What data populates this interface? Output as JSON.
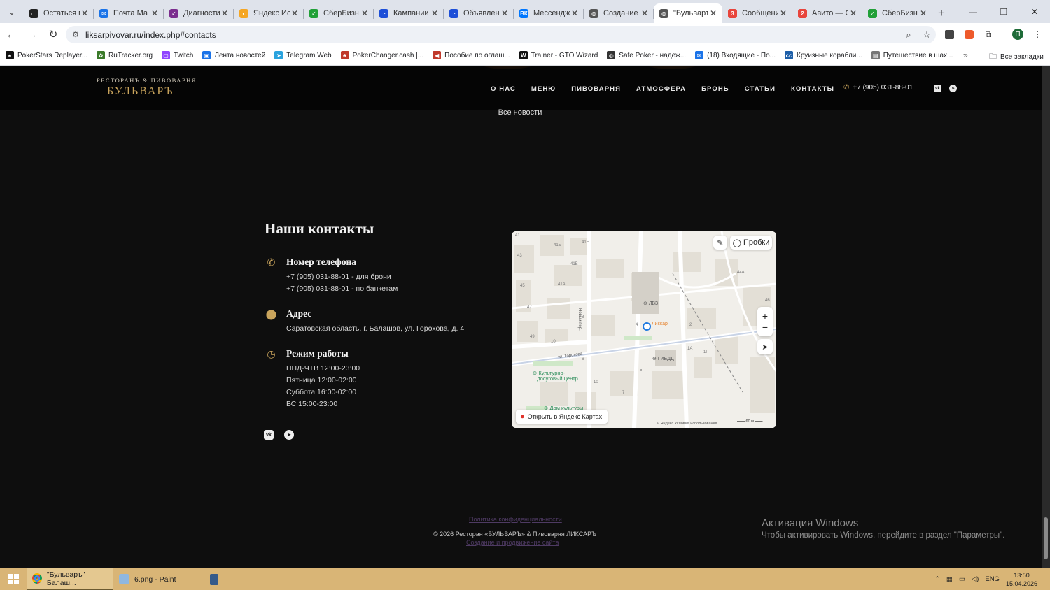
{
  "browser": {
    "tabs": [
      {
        "title": "Остаться в",
        "color": "#222222",
        "glyph": "▭"
      },
      {
        "title": "Почта Ма",
        "color": "#1a73e8",
        "glyph": "✉"
      },
      {
        "title": "Диагности",
        "color": "#7b2d8e",
        "glyph": "✓"
      },
      {
        "title": "Яндекс Ис",
        "color": "#f5a623",
        "glyph": "◐"
      },
      {
        "title": "СберБизн",
        "color": "#21a038",
        "glyph": "✓"
      },
      {
        "title": "Кампании",
        "color": "#1d4fd8",
        "glyph": "◔"
      },
      {
        "title": "Объявлен",
        "color": "#1d4fd8",
        "glyph": "◔"
      },
      {
        "title": "Мессендж",
        "color": "#0077ff",
        "glyph": "ВК"
      },
      {
        "title": "Создание",
        "color": "#555555",
        "glyph": "◍"
      },
      {
        "title": "\"Бульваръ",
        "color": "#555555",
        "glyph": "◍",
        "active": true
      },
      {
        "title": "Сообщени",
        "color": "#e8453c",
        "glyph": "3"
      },
      {
        "title": "Авито — С",
        "color": "#e8453c",
        "glyph": "2"
      },
      {
        "title": "СберБизн",
        "color": "#21a038",
        "glyph": "✓"
      }
    ],
    "url": "liksarpivovar.ru/index.php#contacts",
    "profile_initial": "П",
    "bookmarks": [
      {
        "label": "PokerStars Replayer...",
        "color": "#111111",
        "glyph": "♠"
      },
      {
        "label": "RuTracker.org",
        "color": "#3b7a2a",
        "glyph": "✿"
      },
      {
        "label": "Twitch",
        "color": "#9146ff",
        "glyph": "▢"
      },
      {
        "label": "Лента новостей",
        "color": "#1a73e8",
        "glyph": "▣"
      },
      {
        "label": "Telegram Web",
        "color": "#2aa3de",
        "glyph": "➤"
      },
      {
        "label": "PokerChanger.cash |...",
        "color": "#c0392b",
        "glyph": "♣"
      },
      {
        "label": "Пособие по оглаш...",
        "color": "#c0392b",
        "glyph": "◀"
      },
      {
        "label": "Trainer - GTO Wizard",
        "color": "#111111",
        "glyph": "W"
      },
      {
        "label": "Safe Poker - надеж...",
        "color": "#333333",
        "glyph": "◎"
      },
      {
        "label": "(18) Входящие - По...",
        "color": "#1a73e8",
        "glyph": "✉"
      },
      {
        "label": "Круизные корабли...",
        "color": "#1e5fa8",
        "glyph": "cc"
      },
      {
        "label": "Путешествие в шах...",
        "color": "#777777",
        "glyph": "▤"
      }
    ],
    "all_bookmarks": "Все закладки"
  },
  "site": {
    "logo_top": "РЕСТОРАНЪ & ПИВОВАРНЯ",
    "logo_main": "БУЛЬВАРЪ",
    "menu": [
      "О НАС",
      "МЕНЮ",
      "ПИВОВАРНЯ",
      "АТМОСФЕРА",
      "БРОНЬ",
      "СТАТЬИ",
      "КОНТАКТЫ"
    ],
    "header_phone": "+7 (905) 031-88-01",
    "all_news_button": "Все новости",
    "contacts": {
      "title": "Наши контакты",
      "phone_heading": "Номер телефона",
      "phone_lines": [
        "+7 (905) 031-88-01 - для брони",
        "+7 (905) 031-88-01 - по банкетам"
      ],
      "address_heading": "Адрес",
      "address": "Саратовская область, г. Балашов, ул. Горохова, д. 4",
      "hours_heading": "Режим работы",
      "hours": [
        "ПНД-ЧТВ 12:00-23:00",
        "Пятница 12:00-02:00",
        "Суббота 16:00-02:00",
        "ВС 15:00-23:00"
      ]
    },
    "map": {
      "traffic": "Пробки",
      "open_in_maps": "Открыть в Яндекс Картах",
      "copyright": "© Яндекс   Условия использования",
      "scale": "60 м",
      "labels": {
        "place": "Ликсар",
        "lvz": "ЛВЗ",
        "gibdd": "ГИБДД",
        "culture_center_1": "Культурно-",
        "culture_center_2": "досуговый центр",
        "house_culture": "Дом культуры",
        "street": "ул. Горохова",
        "lane": "Новый пер."
      },
      "house_numbers": [
        "41",
        "41Б",
        "41Е",
        "41В",
        "43",
        "45",
        "41А",
        "47",
        "49",
        "10",
        "8",
        "4",
        "2",
        "1А",
        "1Г",
        "5",
        "10",
        "7",
        "44А",
        "46",
        "6"
      ]
    },
    "footer": {
      "privacy": "Политика конфиденциальности",
      "copyright": "© 2026 Ресторан «БУЛЬВАРЪ» & Пивоварня ЛИКСАРЪ",
      "made_by": "Создание и продвижение сайта"
    }
  },
  "windows": {
    "activation_title": "Активация Windows",
    "activation_sub": "Чтобы активировать Windows, перейдите в раздел \"Параметры\".",
    "taskbar_items": [
      {
        "label": "\"Бульваръ\" Балаш...",
        "active": true
      },
      {
        "label": "6.png - Paint",
        "active": false
      }
    ],
    "lang": "ENG",
    "time": "13:50",
    "date": "15.04.2026"
  },
  "colors": {
    "accent_gold": "#c9a45c",
    "page_bg": "#0e0e0e",
    "taskbar": "#d9b576"
  }
}
